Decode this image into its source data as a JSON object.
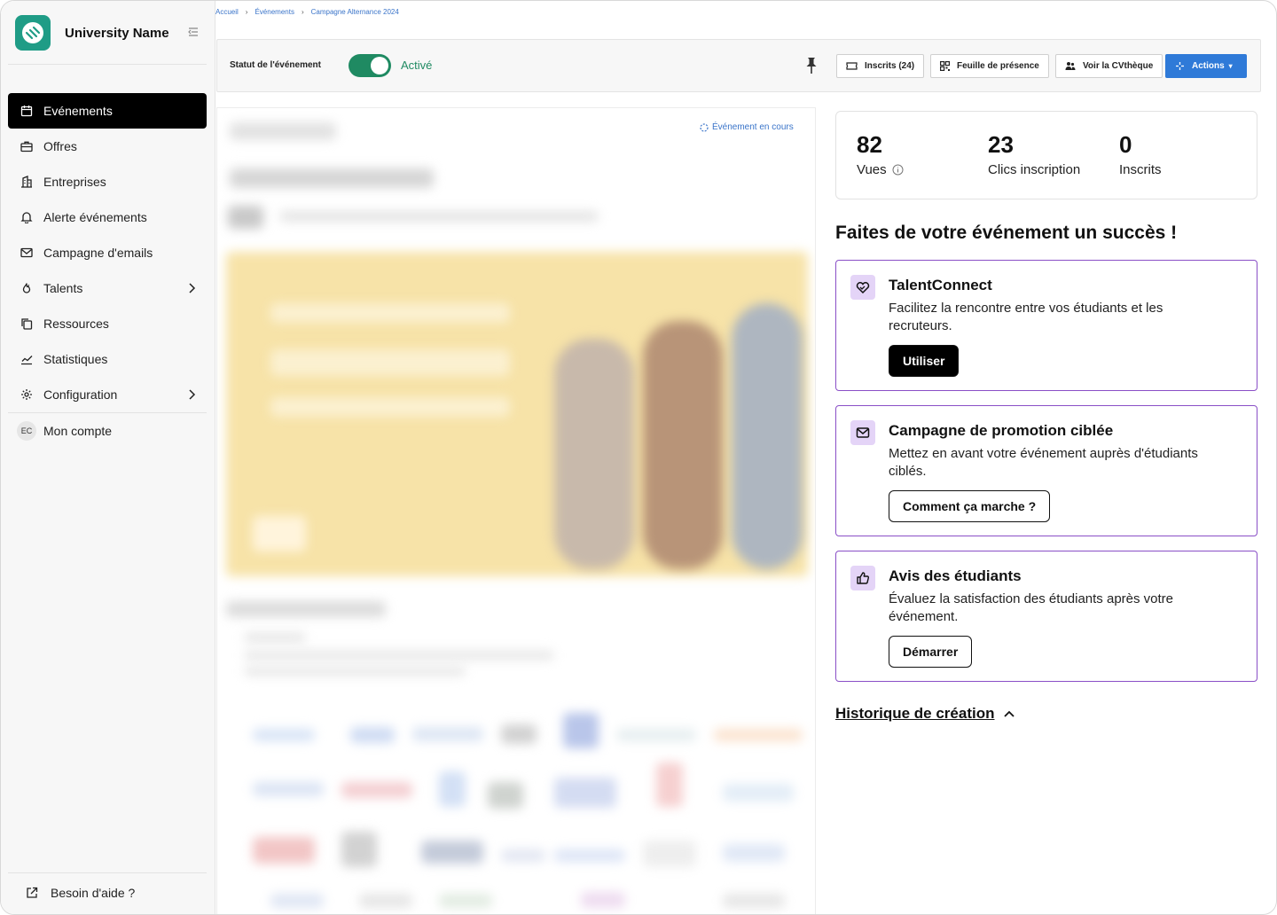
{
  "app": {
    "university_name": "University Name"
  },
  "sidebar": {
    "items": [
      {
        "label": "Evénements",
        "icon": "calendar-icon",
        "active": true
      },
      {
        "label": "Offres",
        "icon": "briefcase-icon"
      },
      {
        "label": "Entreprises",
        "icon": "building-icon"
      },
      {
        "label": "Alerte événements",
        "icon": "bell-icon"
      },
      {
        "label": "Campagne d'emails",
        "icon": "mail-icon"
      },
      {
        "label": "Talents",
        "icon": "flame-icon",
        "has_submenu": true
      },
      {
        "label": "Ressources",
        "icon": "copy-icon"
      },
      {
        "label": "Statistiques",
        "icon": "chart-icon"
      },
      {
        "label": "Configuration",
        "icon": "gear-icon",
        "has_submenu": true
      }
    ],
    "account": {
      "initials": "EC",
      "label": "Mon compte"
    },
    "help_label": "Besoin d'aide ?"
  },
  "breadcrumb": {
    "items": [
      "Accueil",
      "Événements",
      "Campagne Alternance 2024"
    ]
  },
  "topbar": {
    "status_label": "Statut de l'événement",
    "toggle_on": true,
    "toggle_label": "Activé",
    "buttons": {
      "registered": "Inscrits (24)",
      "attendance": "Feuille de présence",
      "cvtheque": "Voir la CVthèque",
      "actions": "Actions"
    }
  },
  "preview": {
    "status": "Événement en cours"
  },
  "stats": {
    "views": {
      "value": "82",
      "label": "Vues"
    },
    "clicks": {
      "value": "23",
      "label": "Clics inscription"
    },
    "registered": {
      "value": "0",
      "label": "Inscrits"
    }
  },
  "promo": {
    "title": "Faites de votre événement un succès !",
    "cards": [
      {
        "title": "TalentConnect",
        "desc": "Facilitez la rencontre entre vos étudiants et les recruteurs.",
        "button": "Utiliser",
        "icon": "heart-handshake-icon"
      },
      {
        "title": "Campagne de promotion ciblée",
        "desc": "Mettez en avant votre événement auprès d'étudiants ciblés.",
        "button": "Comment ça marche ?",
        "icon": "mail-icon"
      },
      {
        "title": "Avis des étudiants",
        "desc": "Évaluez la satisfaction des étudiants après votre événement.",
        "button": "Démarrer",
        "icon": "thumbs-up-icon"
      }
    ]
  },
  "history": {
    "label": "Historique de création"
  },
  "colors": {
    "accent_green": "#1f8a62",
    "brand_teal": "#1f9c86",
    "primary_blue": "#2f7ad8",
    "card_border": "#8a4fc7",
    "link_blue": "#3a74c9"
  }
}
